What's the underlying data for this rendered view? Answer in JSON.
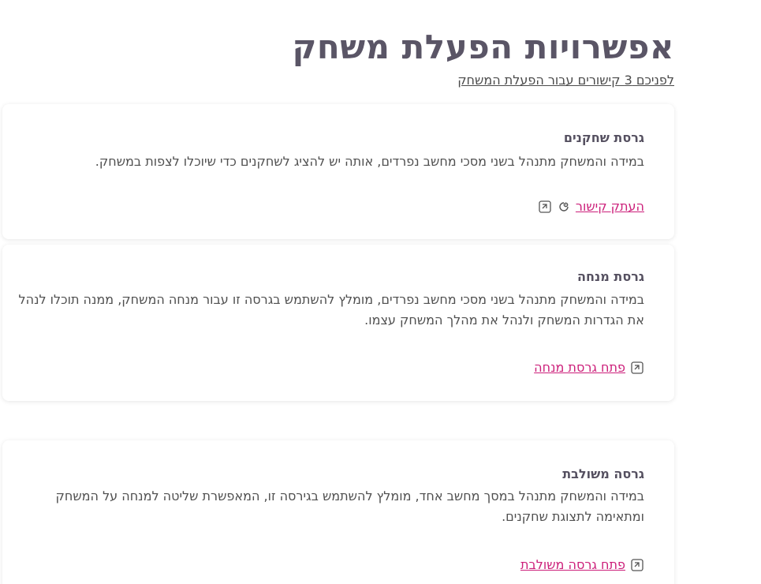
{
  "page": {
    "title": "אפשרויות הפעלת משחק",
    "subtitle_link": "לפניכם 3 קישורים עבור הפעלת המשחק"
  },
  "cards": [
    {
      "title": "גרסת שחקנים",
      "description": "במידה והמשחק מתנהל בשני מסכי מחשב נפרדים, אותה יש להציג לשחקנים כדי שיוכלו לצפות במשחק.",
      "action_label": "העתק קישור",
      "icons": [
        "external-link-icon",
        "copy-link-icon",
        "external-link-icon"
      ]
    },
    {
      "title": "גרסת מנחה",
      "description": "במידה והמשחק מתנהל בשני מסכי מחשב נפרדים, מומלץ להשתמש בגרסה זו עבור מנחה המשחק, ממנה תוכלו לנהל את הגדרות המשחק ולנהל את מהלך המשחק עצמו.",
      "action_label": "פתח גרסת מנחה",
      "icons": [
        "external-link-icon"
      ]
    },
    {
      "title": "גרסה משולבת",
      "description": "במידה והמשחק מתנהל במסך מחשב אחד, מומלץ להשתמש בגירסה זו, המאפשרת שליטה למנחה על המשחק ומתאימה לתצוגת שחקנים.",
      "action_label": "פתח גרסה משולבת",
      "icons": [
        "external-link-icon"
      ]
    }
  ],
  "colors": {
    "title": "#5a5566",
    "link_accent": "#cc1f7a",
    "text": "#4f4f4f"
  }
}
